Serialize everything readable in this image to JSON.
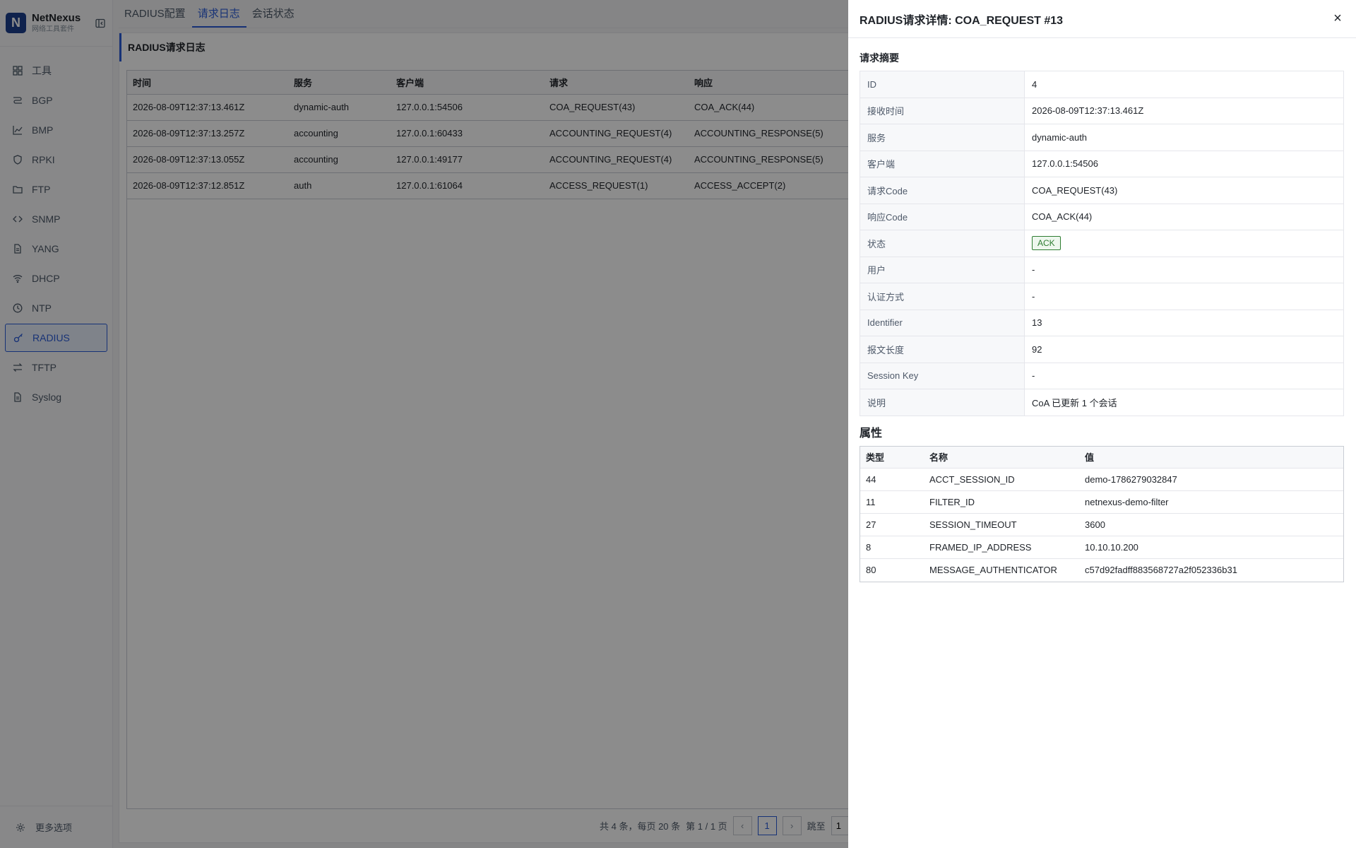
{
  "brand": {
    "logo_letter": "N",
    "name": "NetNexus",
    "subtitle": "网络工具套件"
  },
  "sidebar": {
    "items": [
      {
        "label": "工具",
        "icon": "grid-icon"
      },
      {
        "label": "BGP",
        "icon": "route-icon"
      },
      {
        "label": "BMP",
        "icon": "chart-icon"
      },
      {
        "label": "RPKI",
        "icon": "shield-icon"
      },
      {
        "label": "FTP",
        "icon": "folder-icon"
      },
      {
        "label": "SNMP",
        "icon": "code-icon"
      },
      {
        "label": "YANG",
        "icon": "file-icon"
      },
      {
        "label": "DHCP",
        "icon": "wifi-icon"
      },
      {
        "label": "NTP",
        "icon": "clock-icon"
      },
      {
        "label": "RADIUS",
        "icon": "key-icon",
        "active": true
      },
      {
        "label": "TFTP",
        "icon": "swap-icon"
      },
      {
        "label": "Syslog",
        "icon": "file-icon"
      }
    ],
    "footer_label": "更多选项"
  },
  "tabs": [
    "RADIUS配置",
    "请求日志",
    "会话状态"
  ],
  "log": {
    "title": "RADIUS请求日志",
    "columns": [
      "时间",
      "服务",
      "客户端",
      "请求",
      "响应"
    ],
    "rows": [
      [
        "2026-08-09T12:37:13.461Z",
        "dynamic-auth",
        "127.0.0.1:54506",
        "COA_REQUEST(43)",
        "COA_ACK(44)"
      ],
      [
        "2026-08-09T12:37:13.257Z",
        "accounting",
        "127.0.0.1:60433",
        "ACCOUNTING_REQUEST(4)",
        "ACCOUNTING_RESPONSE(5)"
      ],
      [
        "2026-08-09T12:37:13.055Z",
        "accounting",
        "127.0.0.1:49177",
        "ACCOUNTING_REQUEST(4)",
        "ACCOUNTING_RESPONSE(5)"
      ],
      [
        "2026-08-09T12:37:12.851Z",
        "auth",
        "127.0.0.1:61064",
        "ACCESS_REQUEST(1)",
        "ACCESS_ACCEPT(2)"
      ]
    ]
  },
  "pager": {
    "summary": "共 4 条，每页 20 条",
    "page_info": "第 1 / 1 页",
    "prev": "‹",
    "current": "1",
    "next": "›",
    "jump_label": "跳至",
    "jump_value": "1"
  },
  "drawer": {
    "title": "RADIUS请求详情: COA_REQUEST #13",
    "close": "×",
    "summary_title": "请求摘要",
    "summary": [
      {
        "key": "ID",
        "value": "4"
      },
      {
        "key": "接收时间",
        "value": "2026-08-09T12:37:13.461Z"
      },
      {
        "key": "服务",
        "value": "dynamic-auth"
      },
      {
        "key": "客户端",
        "value": "127.0.0.1:54506"
      },
      {
        "key": "请求Code",
        "value": "COA_REQUEST(43)"
      },
      {
        "key": "响应Code",
        "value": "COA_ACK(44)"
      },
      {
        "key": "状态",
        "value": "ACK",
        "badge": true
      },
      {
        "key": "用户",
        "value": "-"
      },
      {
        "key": "认证方式",
        "value": "-"
      },
      {
        "key": "Identifier",
        "value": "13"
      },
      {
        "key": "报文长度",
        "value": "92"
      },
      {
        "key": "Session Key",
        "value": "-"
      },
      {
        "key": "说明",
        "value": "CoA 已更新 1 个会话"
      }
    ],
    "attrs_title": "属性",
    "attr_columns": [
      "类型",
      "名称",
      "值"
    ],
    "attrs": [
      [
        "44",
        "ACCT_SESSION_ID",
        "demo-1786279032847"
      ],
      [
        "11",
        "FILTER_ID",
        "netnexus-demo-filter"
      ],
      [
        "27",
        "SESSION_TIMEOUT",
        "3600"
      ],
      [
        "8",
        "FRAMED_IP_ADDRESS",
        "10.10.10.200"
      ],
      [
        "80",
        "MESSAGE_AUTHENTICATOR",
        "c57d92fadff883568727a2f052336b31"
      ]
    ]
  }
}
